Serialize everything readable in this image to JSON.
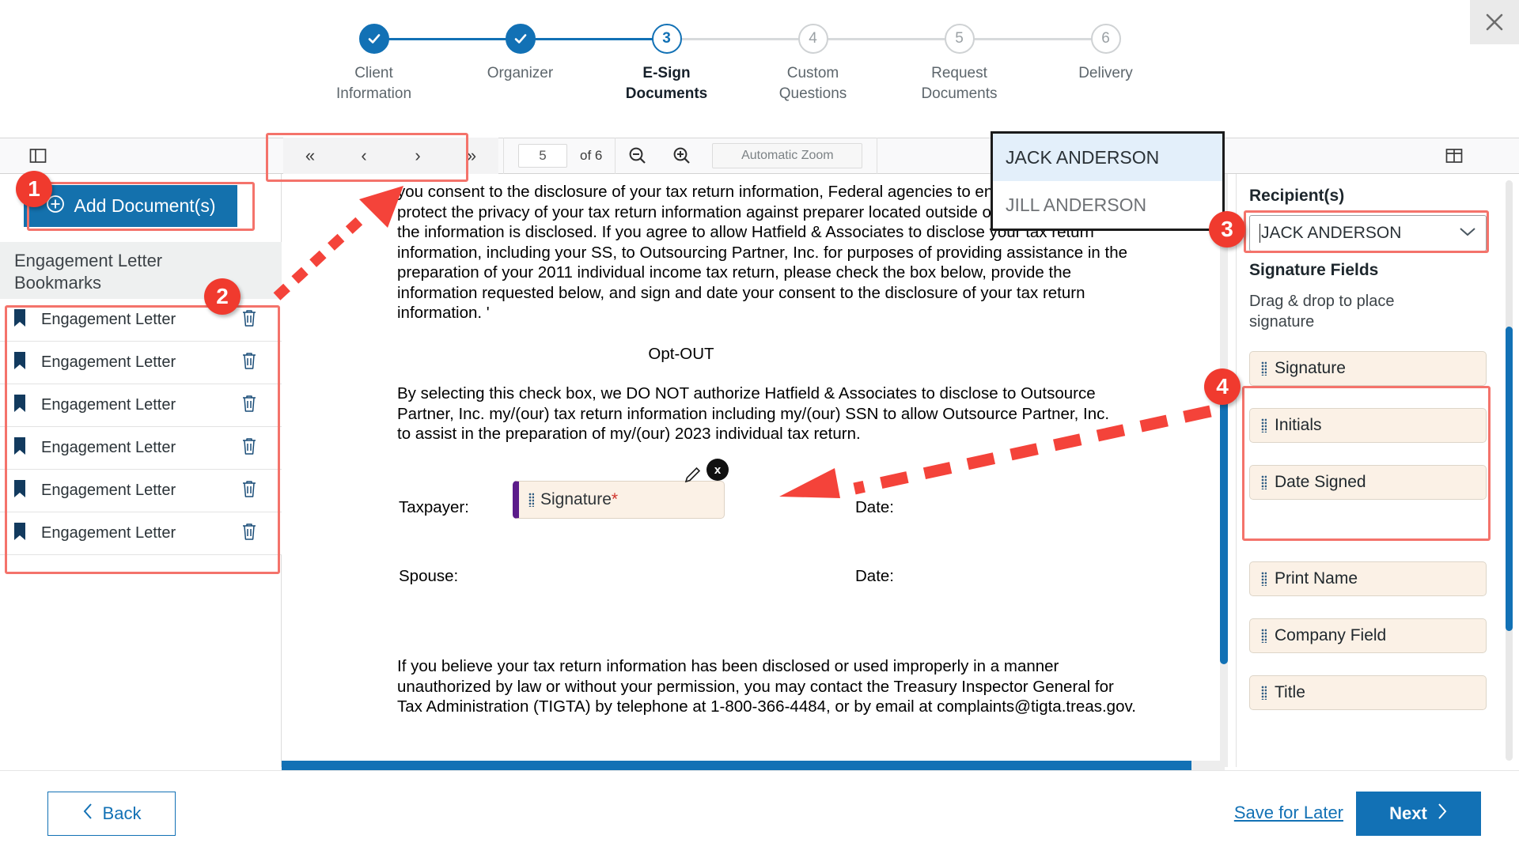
{
  "window": {
    "close_icon": "close-icon"
  },
  "stepper": {
    "steps": [
      {
        "num": "1",
        "label": "Client\nInformation",
        "state": "done",
        "check": "check-icon"
      },
      {
        "num": "2",
        "label": "Organizer",
        "state": "done",
        "check": "check-icon"
      },
      {
        "num": "3",
        "label": "E-Sign\nDocuments",
        "state": "current",
        "check": ""
      },
      {
        "num": "4",
        "label": "Custom\nQuestions",
        "state": "todo",
        "check": ""
      },
      {
        "num": "5",
        "label": "Request\nDocuments",
        "state": "todo",
        "check": ""
      },
      {
        "num": "6",
        "label": "Delivery",
        "state": "todo",
        "check": ""
      }
    ]
  },
  "toolbar": {
    "sidebar_toggle_icon": "sidebar-toggle-icon",
    "first_page": "«",
    "prev_page": "‹",
    "next_page": "›",
    "last_page": "»",
    "page_number": "5",
    "page_of": "of 6",
    "zoom_out_icon": "zoom-out-icon",
    "zoom_in_icon": "zoom-in-icon",
    "zoom_level": "Automatic Zoom",
    "right_toggle_icon": "panel-toggle-icon"
  },
  "sidebar": {
    "add_documents_label": "Add Document(s)",
    "add_icon": "plus-circle-icon",
    "bookmarks_title": "Engagement Letter\nBookmarks",
    "bookmarks": [
      {
        "label": "Engagement Letter",
        "icon": "bookmark-icon",
        "delete_icon": "trash-icon"
      },
      {
        "label": "Engagement Letter",
        "icon": "bookmark-icon",
        "delete_icon": "trash-icon"
      },
      {
        "label": "Engagement Letter",
        "icon": "bookmark-icon",
        "delete_icon": "trash-icon"
      },
      {
        "label": "Engagement Letter",
        "icon": "bookmark-icon",
        "delete_icon": "trash-icon"
      },
      {
        "label": "Engagement Letter",
        "icon": "bookmark-icon",
        "delete_icon": "trash-icon"
      },
      {
        "label": "Engagement Letter",
        "icon": "bookmark-icon",
        "delete_icon": "trash-icon"
      }
    ]
  },
  "document": {
    "para1": "you consent to the disclosure of your tax return information, Federal agencies to enforce US laws that protect the privacy of your tax return information against preparer located outside of the US to which the information is disclosed. If you agree to allow Hatfield & Associates to disclose your tax return information, including your SS, to Outsourcing Partner, Inc. for purposes of providing assistance in the preparation of your 2011 individual income tax return, please check the box below, provide the information requested below, and sign and date your consent to the disclosure of your tax return information. '",
    "optout_heading": "Opt-OUT",
    "para2": "By selecting this check box, we DO NOT authorize Hatfield & Associates to disclose to Outsource Partner, Inc. my/(our) tax return information including my/(our) SSN to allow Outsource Partner, Inc. to assist in the preparation of my/(our) 2023 individual tax return.",
    "taxpayer_label": "Taxpayer:",
    "spouse_label": "Spouse:",
    "date_label_1": "Date:",
    "date_label_2": "Date:",
    "placed_signature": {
      "label": "Signature",
      "required_mark": "*",
      "edit_icon": "pencil-icon",
      "remove_icon": "remove-x-icon",
      "grip_icon": "drag-grip-icon"
    },
    "para3": "    If you believe your tax return information has been disclosed or used improperly in a manner unauthorized by law or without your permission, you may contact the Treasury Inspector General for Tax Administration (TIGTA) by telephone at 1-800-366-4484, or by email at complaints@tigta.treas.gov."
  },
  "recipient_dropdown": {
    "options": [
      {
        "label": "JACK ANDERSON",
        "selected": true
      },
      {
        "label": "JILL ANDERSON",
        "selected": false
      }
    ]
  },
  "right_panel": {
    "recipients_label": "Recipient(s)",
    "recipient_value": "JACK ANDERSON",
    "dropdown_icon": "chevron-down-icon",
    "signature_fields_label": "Signature Fields",
    "drag_hint": "Drag & drop to place signature",
    "fields_group_1": [
      {
        "label": "Signature",
        "grip": "drag-grip-icon"
      },
      {
        "label": "Initials",
        "grip": "drag-grip-icon"
      },
      {
        "label": "Date Signed",
        "grip": "drag-grip-icon"
      }
    ],
    "fields_group_2": [
      {
        "label": "Print Name",
        "grip": "drag-grip-icon"
      },
      {
        "label": "Company Field",
        "grip": "drag-grip-icon"
      },
      {
        "label": "Title",
        "grip": "drag-grip-icon"
      }
    ]
  },
  "footer": {
    "back_label": "Back",
    "back_icon": "chevron-left-icon",
    "save_for_later_label": "Save for Later",
    "next_label": "Next",
    "next_icon": "chevron-right-icon"
  },
  "annotations": {
    "badges": [
      {
        "num": "1"
      },
      {
        "num": "2"
      },
      {
        "num": "3"
      },
      {
        "num": "4"
      }
    ],
    "accent_color": "#f03a2e",
    "highlight_color": "#f4736b"
  },
  "colors": {
    "brand_blue": "#1271b5",
    "field_beige": "#fbf1e6",
    "signature_bar_purple": "#5b1b8a"
  }
}
